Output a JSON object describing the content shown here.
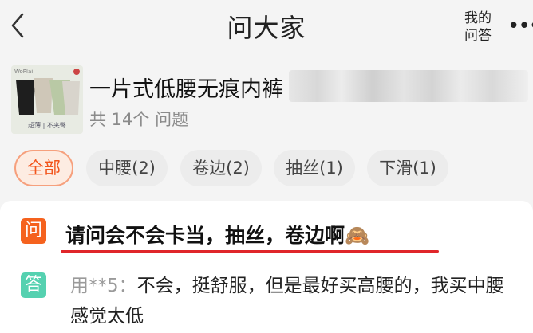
{
  "header": {
    "title": "问大家",
    "my_questions_line1": "我的",
    "my_questions_line2": "问答",
    "more": "•••"
  },
  "product": {
    "name": "一片式低腰无痕内裤",
    "question_count": "共 14个 问题",
    "thumb_brand": "WoPlai",
    "thumb_caption": "超薄 | 不夹臀"
  },
  "filters": [
    {
      "label": "全部",
      "active": true
    },
    {
      "label": "中腰(2)",
      "active": false
    },
    {
      "label": "卷边(2)",
      "active": false
    },
    {
      "label": "抽丝(1)",
      "active": false
    },
    {
      "label": "下滑(1)",
      "active": false
    }
  ],
  "qa": {
    "question_badge": "问",
    "question": "请问会不会卡当，抽丝，卷边啊",
    "question_emoji": "🙈",
    "answer_badge": "答",
    "answer_user": "用**5：",
    "answer_text": "不会，挺舒服，但是最好买高腰的，我买中腰感觉太低"
  },
  "colors": {
    "accent": "#f2541b",
    "question_badge": "#f5621e",
    "answer_badge": "#55d1b0",
    "underline": "#e0262a"
  }
}
